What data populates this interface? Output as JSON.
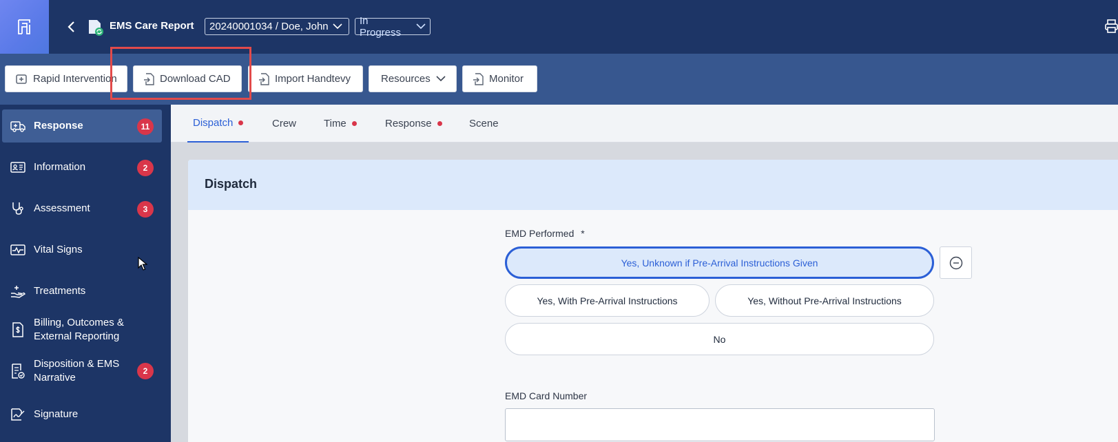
{
  "header": {
    "title": "EMS Care Report",
    "patient_selector": "20240001034 / Doe, John",
    "status_selector": "In Progress"
  },
  "toolbar": {
    "buttons": [
      {
        "label": "Rapid Intervention",
        "icon": "ambulance-icon"
      },
      {
        "label": "Download CAD",
        "icon": "file-import-icon"
      },
      {
        "label": "Import Handtevy",
        "icon": "file-import-icon"
      },
      {
        "label": "Resources",
        "icon": "chevron-down-icon"
      },
      {
        "label": "Monitor",
        "icon": "file-import-icon"
      }
    ]
  },
  "sidebar": {
    "items": [
      {
        "label": "Response",
        "badge": "11",
        "icon": "ambulance-icon",
        "active": true
      },
      {
        "label": "Information",
        "badge": "2",
        "icon": "id-card-icon"
      },
      {
        "label": "Assessment",
        "badge": "3",
        "icon": "stethoscope-icon"
      },
      {
        "label": "Vital Signs",
        "badge": "",
        "icon": "pulse-icon"
      },
      {
        "label": "Treatments",
        "badge": "",
        "icon": "hand-medical-icon"
      },
      {
        "label": "Billing, Outcomes & External Reporting",
        "badge": "",
        "icon": "billing-doc-icon"
      },
      {
        "label": "Disposition & EMS Narrative",
        "badge": "2",
        "icon": "checklist-icon"
      },
      {
        "label": "Signature",
        "badge": "",
        "icon": "signature-icon"
      }
    ]
  },
  "tabs": [
    {
      "label": "Dispatch",
      "dot": true,
      "active": true
    },
    {
      "label": "Crew",
      "dot": false
    },
    {
      "label": "Time",
      "dot": true
    },
    {
      "label": "Response",
      "dot": true
    },
    {
      "label": "Scene",
      "dot": false
    }
  ],
  "section": {
    "title": "Dispatch",
    "emd_performed": {
      "label": "EMD Performed",
      "required_mark": "*",
      "options": [
        {
          "label": "Yes, Unknown if Pre-Arrival Instructions Given",
          "selected": true
        },
        {
          "label": "Yes, With Pre-Arrival Instructions",
          "selected": false
        },
        {
          "label": "Yes, Without Pre-Arrival Instructions",
          "selected": false
        },
        {
          "label": "No",
          "selected": false
        }
      ]
    },
    "emd_card_number": {
      "label": "EMD Card Number",
      "value": ""
    }
  },
  "colors": {
    "nav_dark": "#1d3566",
    "toolbar": "#37578f",
    "accent": "#2b5fd6",
    "badge": "#d9364a",
    "highlight": "#e24a4a"
  }
}
